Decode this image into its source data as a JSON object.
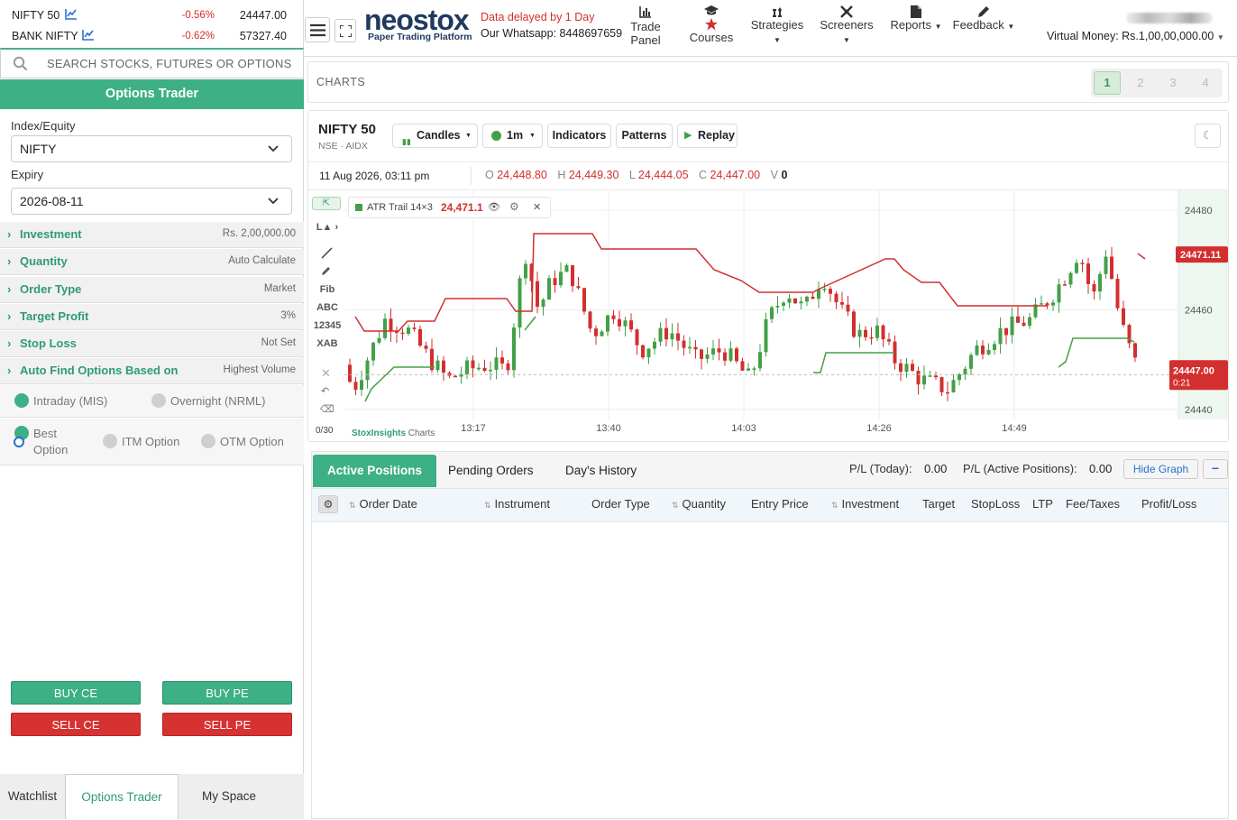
{
  "tickers": [
    {
      "name": "NIFTY 50",
      "change": "-0.56%",
      "price": "24447.00"
    },
    {
      "name": "BANK NIFTY",
      "change": "-0.62%",
      "price": "57327.40"
    }
  ],
  "search": {
    "placeholder": "SEARCH STOCKS, FUTURES OR OPTIONS"
  },
  "options_trader": {
    "title": "Options Trader",
    "index_label": "Index/Equity",
    "index_value": "NIFTY",
    "expiry_label": "Expiry",
    "expiry_value": "2026-08-11",
    "fields": [
      {
        "label": "Investment",
        "value": "Rs. 2,00,000.00"
      },
      {
        "label": "Quantity",
        "value": "Auto Calculate"
      },
      {
        "label": "Order Type",
        "value": "Market"
      },
      {
        "label": "Target Profit",
        "value": "3%"
      },
      {
        "label": "Stop Loss",
        "value": "Not Set"
      },
      {
        "label": "Auto Find Options Based on",
        "value": "Highest Volume"
      }
    ],
    "product": {
      "intraday": "Intraday (MIS)",
      "overnight": "Overnight (NRML)"
    },
    "option_choice": {
      "best_line1": "Best",
      "best_line2": "Option",
      "itm": "ITM Option",
      "otm": "OTM Option"
    },
    "buttons": {
      "buy_ce": "BUY CE",
      "buy_pe": "BUY PE",
      "sell_ce": "SELL CE",
      "sell_pe": "SELL PE"
    }
  },
  "bottom_tabs": [
    "Watchlist",
    "Options Trader",
    "My Space"
  ],
  "header": {
    "brand": "neostox",
    "brand_sub": "Paper Trading Platform",
    "delay_text": "Data delayed by 1 Day",
    "whatsapp": "Our Whatsapp: 8448697659",
    "nav": [
      {
        "line1": "Trade",
        "line2": "Panel"
      },
      {
        "line1": "",
        "line2": "Courses"
      },
      {
        "line1": "Strategies",
        "line2": ""
      },
      {
        "line1": "Screeners",
        "line2": ""
      },
      {
        "line1": "Reports",
        "line2": ""
      },
      {
        "line1": "Feedback",
        "line2": ""
      }
    ],
    "virtual_money_label": "Virtual Money:",
    "virtual_money_value": "Rs.1,00,00,000.00"
  },
  "charts_panel": {
    "title": "CHARTS",
    "pages": [
      "1",
      "2",
      "3",
      "4"
    ],
    "active_page": "1"
  },
  "chart_toolbar": {
    "symbol": "NIFTY 50",
    "exchange": "NSE · AIDX",
    "chart_style": "Candles",
    "interval": "1m",
    "indicators": "Indicators",
    "patterns": "Patterns",
    "replay": "Replay"
  },
  "ohlc": {
    "datetime": "11 Aug 2026, 03:11 pm",
    "o_label": "O",
    "o": "24,448.80",
    "h_label": "H",
    "h": "24,449.30",
    "l_label": "L",
    "l": "24,444.05",
    "c_label": "C",
    "c": "24,447.00",
    "v_label": "V",
    "v": "0"
  },
  "indicator": {
    "name": "ATR Trail 14×3",
    "value": "24,471.1"
  },
  "drawing_tools": [
    "Fib",
    "ABC",
    "12345",
    "XAB"
  ],
  "counter": "0/30",
  "watermark": {
    "part1": "StoxInsights",
    "part2": " Charts"
  },
  "chart_data": {
    "type": "candlestick",
    "x_ticks": [
      "13:17",
      "13:40",
      "14:03",
      "14:26",
      "14:49"
    ],
    "y_ticks": [
      24440,
      24460,
      24480
    ],
    "ylim": [
      24438,
      24484
    ],
    "last_price_label": "24447.00",
    "countdown": "0:21",
    "indicator_label": "24471.11",
    "series": [
      {
        "name": "ATR Trail 14×3",
        "type": "step-line"
      }
    ]
  },
  "positions": {
    "tabs": [
      "Active Positions",
      "Pending Orders",
      "Day's History"
    ],
    "pl_today_label": "P/L (Today):",
    "pl_today": "0.00",
    "pl_active_label": "P/L (Active Positions):",
    "pl_active": "0.00",
    "hide_graph": "Hide Graph",
    "collapse": "−",
    "columns": [
      "Order Date",
      "Instrument",
      "Order Type",
      "Quantity",
      "Entry Price",
      "Investment",
      "Target",
      "StopLoss",
      "LTP",
      "Fee/Taxes",
      "Profit/Loss"
    ]
  },
  "colors": {
    "accent": "#3db085",
    "up": "#43a047",
    "down": "#d32f2f"
  }
}
